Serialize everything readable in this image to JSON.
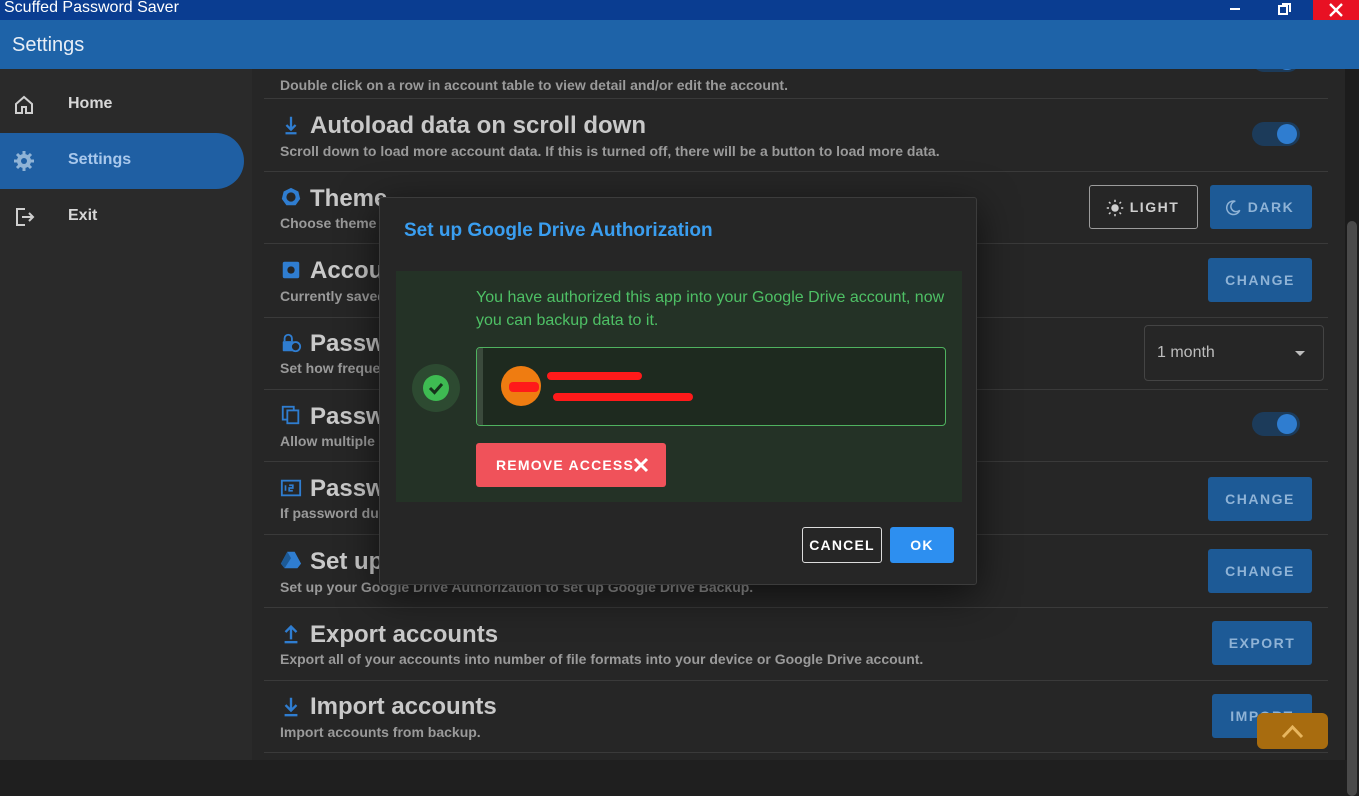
{
  "window": {
    "title": "Scuffed Password Saver",
    "controls": [
      "minimize",
      "restore",
      "close"
    ]
  },
  "appbar": {
    "title": "Settings"
  },
  "sidebar": {
    "items": [
      {
        "label": "Home",
        "icon": "home-icon",
        "active": false
      },
      {
        "label": "Settings",
        "icon": "gear-icon",
        "active": true
      },
      {
        "label": "Exit",
        "icon": "exit-icon",
        "active": false
      }
    ]
  },
  "settings": {
    "row0": {
      "desc": "Double click on a row in account table to view detail and/or edit the account.",
      "toggle_on": true
    },
    "row1": {
      "title": "Autoload data on scroll down",
      "desc": "Scroll down to load more account data. If this is turned off, there will be a button to load more data.",
      "toggle_on": true
    },
    "row2": {
      "title": "Theme",
      "desc": "Choose theme f",
      "light_label": "LIGHT",
      "dark_label": "DARK",
      "selected": "DARK"
    },
    "row3": {
      "title": "Accou",
      "desc": "Currently saved",
      "button": "CHANGE"
    },
    "row4": {
      "title": "Passw",
      "desc": "Set how freque",
      "select_value": "1 month"
    },
    "row5": {
      "title": "Passw",
      "desc": "Allow multiple a",
      "toggle_on": true
    },
    "row6": {
      "title": "Passw",
      "desc": "If password dup",
      "button": "CHANGE"
    },
    "row7": {
      "title": "Set up",
      "desc": "Set up your Google Drive Authorization to set up Google Drive Backup.",
      "button": "CHANGE"
    },
    "row8": {
      "title": "Export accounts",
      "desc": "Export all of your accounts into number of file formats into your device or Google Drive account.",
      "button": "EXPORT"
    },
    "row9": {
      "title": "Import accounts",
      "desc": "Import accounts from backup.",
      "button": "IMPORT"
    }
  },
  "dialog": {
    "title": "Set up Google Drive Authorization",
    "message": "You have authorized this app into your Google Drive account, now you can backup data to it.",
    "remove_label": "REMOVE ACCESS",
    "cancel_label": "CANCEL",
    "ok_label": "OK"
  },
  "colors": {
    "titlebar": "#0a3d91",
    "appbar": "#1e63a8",
    "accent": "#2d8ff0",
    "success": "#4ec065",
    "danger": "#f0525a",
    "fab": "#a86c0f"
  }
}
